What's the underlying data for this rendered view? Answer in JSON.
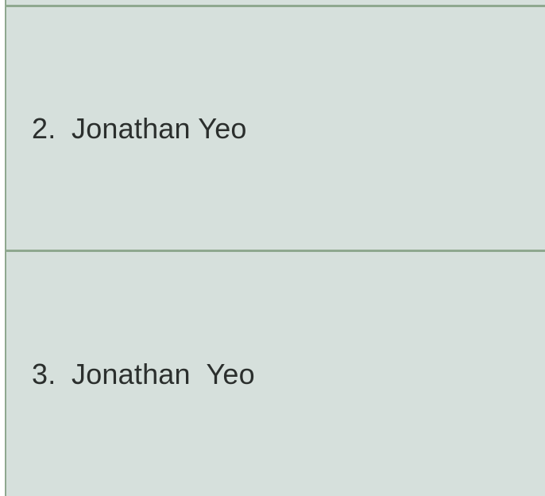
{
  "list": {
    "items": [
      {
        "number": "2.",
        "label": "Jonathan Yeo"
      },
      {
        "number": "3.",
        "label": "Jonathan  Yeo"
      }
    ]
  }
}
